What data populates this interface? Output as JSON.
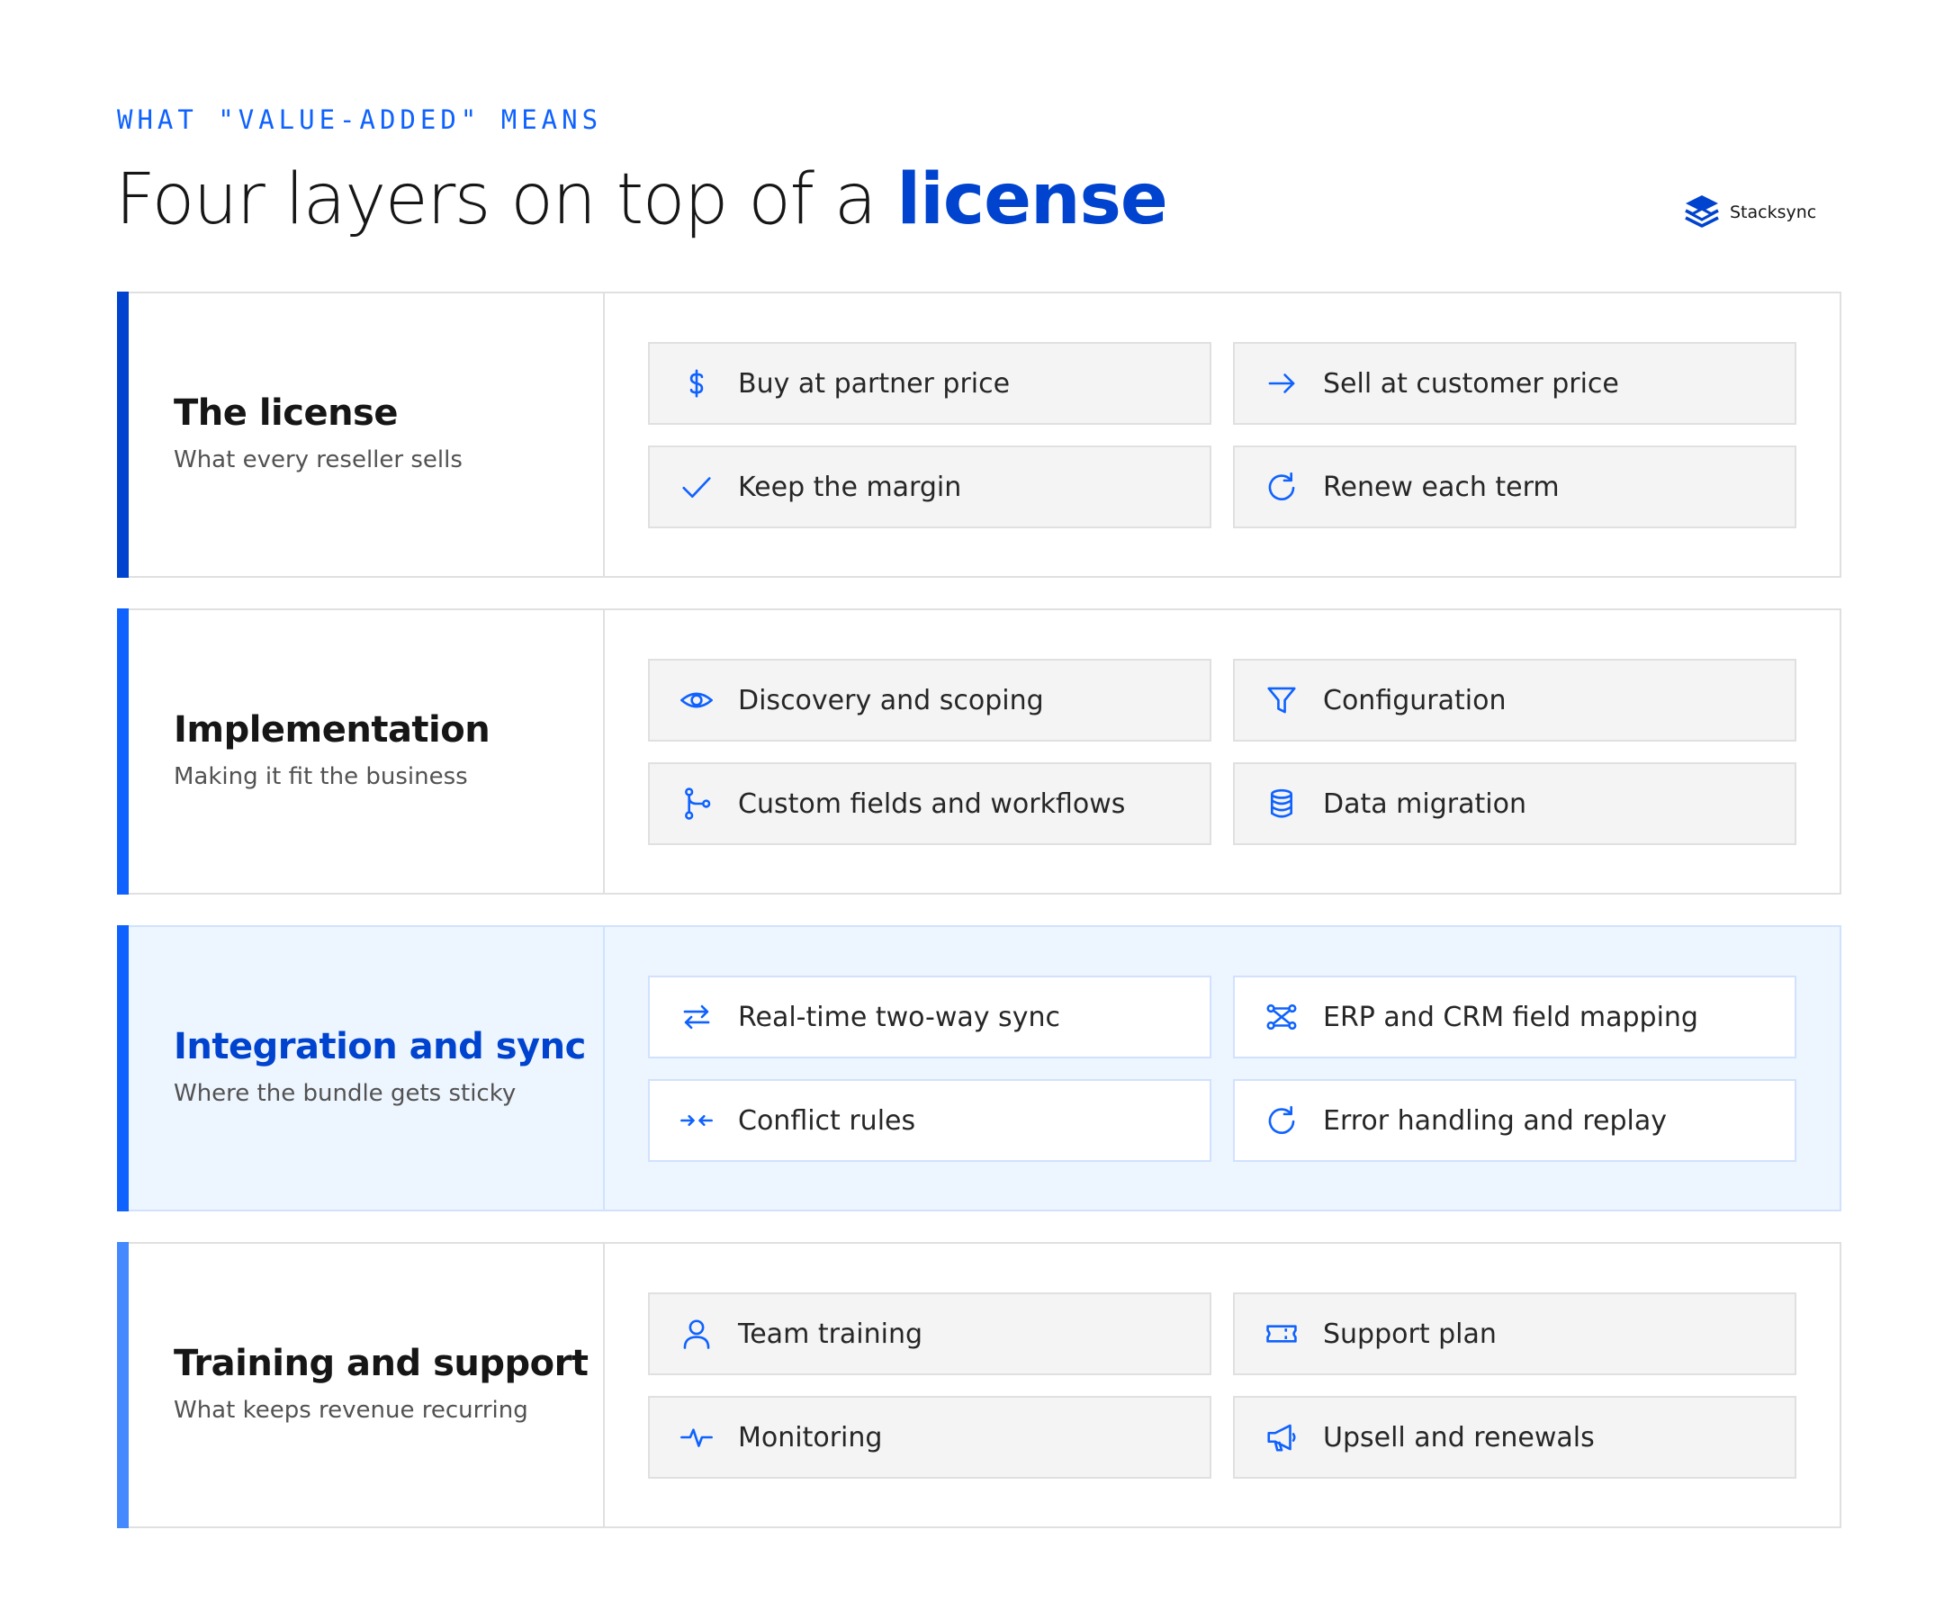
{
  "header": {
    "eyebrow": "WHAT \"VALUE-ADDED\" MEANS",
    "title_prefix": "Four layers on top of a ",
    "title_accent": "license"
  },
  "logo": {
    "text": "Stacksync"
  },
  "colors": {
    "accent": "#0043ce",
    "bar_1": "#0043ce",
    "bar_2": "#0f62fe",
    "bar_3": "#0f62fe",
    "bar_4": "#4589ff",
    "highlight_bg": "#edf5ff"
  },
  "layers": [
    {
      "title": "The license",
      "subtitle": "What every reseller sells",
      "items": [
        {
          "label": "Buy at partner price",
          "icon": "dollar-icon"
        },
        {
          "label": "Sell at customer price",
          "icon": "arrow-right-icon"
        },
        {
          "label": "Keep the margin",
          "icon": "checkmark-icon"
        },
        {
          "label": "Renew each term",
          "icon": "renew-icon"
        }
      ]
    },
    {
      "title": "Implementation",
      "subtitle": "Making it fit the business",
      "items": [
        {
          "label": "Discovery and scoping",
          "icon": "eye-icon"
        },
        {
          "label": "Configuration",
          "icon": "filter-icon"
        },
        {
          "label": "Custom fields and workflows",
          "icon": "branch-icon"
        },
        {
          "label": "Data migration",
          "icon": "database-icon"
        }
      ]
    },
    {
      "title": "Integration and sync",
      "subtitle": "Where the bundle gets sticky",
      "items": [
        {
          "label": "Real-time two-way sync",
          "icon": "arrows-horizontal-icon"
        },
        {
          "label": "ERP and CRM field mapping",
          "icon": "data-connected-icon"
        },
        {
          "label": "Conflict rules",
          "icon": "arrows-inward-icon"
        },
        {
          "label": "Error handling and replay",
          "icon": "renew-icon"
        }
      ]
    },
    {
      "title": "Training and support",
      "subtitle": "What keeps revenue recurring",
      "items": [
        {
          "label": "Team training",
          "icon": "user-icon"
        },
        {
          "label": "Support plan",
          "icon": "ticket-icon"
        },
        {
          "label": "Monitoring",
          "icon": "activity-icon"
        },
        {
          "label": "Upsell and renewals",
          "icon": "megaphone-icon"
        }
      ]
    }
  ]
}
